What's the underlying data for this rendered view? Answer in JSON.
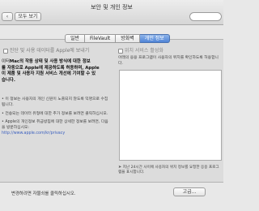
{
  "window": {
    "title": "보안 및 개인 정보"
  },
  "toolbar": {
    "back_icon": "‹",
    "forward_icon": "›",
    "show_all_label": "모두 보기"
  },
  "tabs": [
    {
      "label": "일반",
      "active": false
    },
    {
      "label": "FileVault",
      "active": false
    },
    {
      "label": "방화벽",
      "active": false
    },
    {
      "label": "개인 정보",
      "active": true
    }
  ],
  "left": {
    "send_diagnostics_label": "진단 및 사용 데이터를 Apple에 보내기",
    "description_prefix": "이터",
    "description_bold": "Mac의 작동 상태 및 사용 방식에 대한 정보",
    "description_line2": "를 자동으로 Apple에 제공하도록 허용하며, Apple",
    "description_line3": "이 제품 및 사용자 지원 서비스 개선에 기여할 수 있",
    "description_line4": "습니다.",
    "bullet1": "• 이 정보는 사용자의 개인 신원이 노출되지 않도록 익명으로 수집됩니다.",
    "bullet2": "• 전송되는 데이터 유형에 대한 추가 정보를 보려면 클릭하십시오.",
    "bullet3_prefix": "• Apple의 개인정보 취급방침에 대한 상세한 정보를 보려면, 다음을 방문하십시오:",
    "privacy_link": "http://www.apple.com/kr/privacy"
  },
  "right": {
    "location_services_label": "위치 서비스 활성화",
    "location_desc": "아래의 응용 프로그램이 사용자의 위치를 확인하도록 허용합니다.",
    "location_note": "지난 24시간 사이에 사용자의 위치 정보를 요청한 응용 프로그램을 표시합니다."
  },
  "footer": {
    "note": "변경하려면 자물쇠를 클릭하십시오.",
    "advanced_label": "고급..."
  }
}
